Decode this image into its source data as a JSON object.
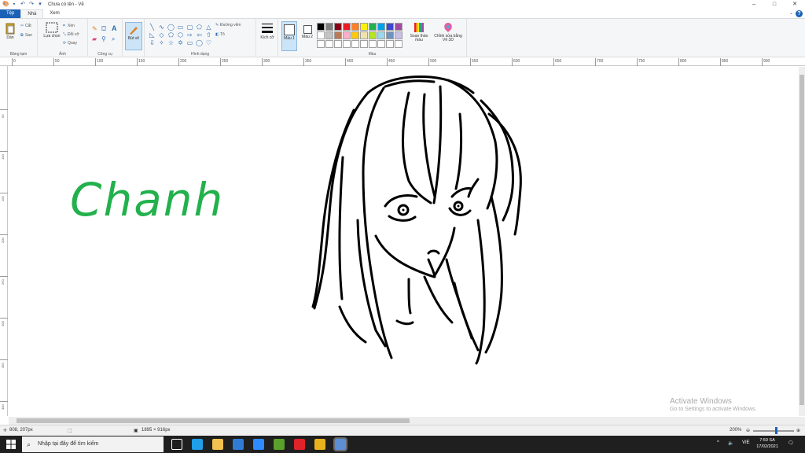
{
  "window": {
    "title": "Chưa có tên - Vẽ",
    "controls": {
      "minimize": "–",
      "maximize": "□",
      "close": "✕"
    }
  },
  "tabs": {
    "file": "Tệp",
    "home": "Nhà",
    "view": "Xem"
  },
  "ribbon": {
    "clipboard": {
      "label": "Bảng tạm",
      "paste": "Dán",
      "cut": "Cắt",
      "copy": "Sao"
    },
    "image": {
      "label": "Ảnh",
      "select": "Lựa chọn",
      "crop": "Xén",
      "resize": "Đổi cỡ",
      "rotate": "Quay"
    },
    "tools": {
      "label": "Công cụ",
      "brushes": "Bút vẽ"
    },
    "shapes": {
      "label": "Hình dạng",
      "outline": "Đường viền",
      "fill": "Tô"
    },
    "size": {
      "label": "Kích cỡ"
    },
    "colors": {
      "label": "Màu",
      "color1": "Màu 1",
      "color2": "Màu 2",
      "edit_colors": "Soạn thảo màu",
      "edit_with_paint3d": "Chỉnh sửa bằng Vẽ 3D",
      "palette": [
        "#000000",
        "#7f7f7f",
        "#880015",
        "#ed1c24",
        "#ff7f27",
        "#fff200",
        "#22b14c",
        "#00a2e8",
        "#3f48cc",
        "#a349a4",
        "#ffffff",
        "#c3c3c3",
        "#b97a57",
        "#ffaec9",
        "#ffc90e",
        "#efe4b0",
        "#b5e61d",
        "#99d9ea",
        "#7092be",
        "#c8bfe7",
        "#ffffff",
        "#ffffff",
        "#ffffff",
        "#ffffff",
        "#ffffff",
        "#ffffff",
        "#ffffff",
        "#ffffff",
        "#ffffff",
        "#ffffff"
      ]
    }
  },
  "ruler": {
    "h_labels": [
      "0",
      "50",
      "100",
      "150",
      "200",
      "250",
      "300",
      "350",
      "400",
      "450",
      "500",
      "550",
      "600",
      "650",
      "700",
      "750",
      "800",
      "850",
      "900"
    ],
    "v_labels": [
      "50",
      "100",
      "150",
      "200",
      "250",
      "300",
      "350",
      "400"
    ]
  },
  "canvas": {
    "handwritten_text": "Chanh",
    "text_color": "#22b14c",
    "stroke_color": "#000000"
  },
  "watermark": {
    "title": "Activate Windows",
    "subtitle": "Go to Settings to activate Windows."
  },
  "statusbar": {
    "cursor_position": "808, 207px",
    "image_size": "1895 × 916px",
    "zoom": "200%"
  },
  "taskbar": {
    "search_placeholder": "Nhập tại đây để tìm kiếm",
    "language": "VIE",
    "time": "7:50 SA",
    "date": "17/02/2021",
    "apps": [
      {
        "name": "task-view",
        "color": "#ffffff"
      },
      {
        "name": "edge",
        "color": "#1f9fe8"
      },
      {
        "name": "file-explorer",
        "color": "#f2c14e"
      },
      {
        "name": "mail",
        "color": "#2f7bd6"
      },
      {
        "name": "zoom",
        "color": "#2d8cff"
      },
      {
        "name": "app-green",
        "color": "#5aa02c"
      },
      {
        "name": "opera",
        "color": "#e0232a"
      },
      {
        "name": "chrome",
        "color": "#e8b21f"
      },
      {
        "name": "paint",
        "color": "#5c8fd6"
      }
    ]
  }
}
